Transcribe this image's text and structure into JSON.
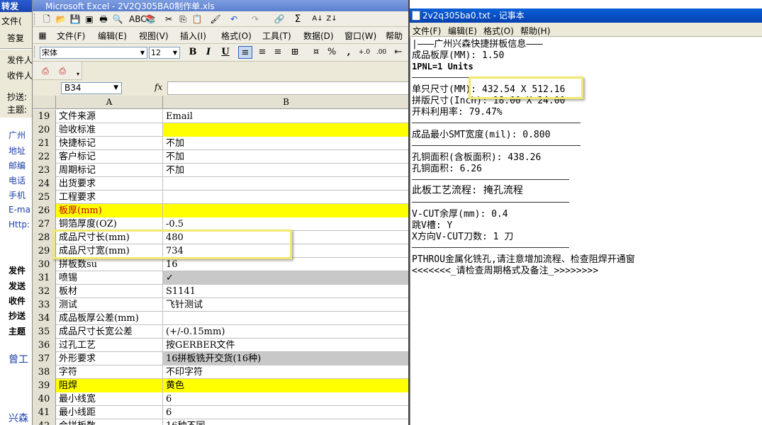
{
  "mail": {
    "title": "转发",
    "toolbar": [
      "文件(",
      "答复"
    ],
    "header_labels": [
      "发件人",
      "收件人",
      "抄送:",
      "主题:"
    ],
    "body_lines": [
      "广州",
      "地址",
      "邮编",
      "电话",
      "手机",
      "E-ma",
      "Http:"
    ],
    "bold_labels": [
      "发件",
      "发送",
      "收件",
      "抄送",
      "主题"
    ],
    "body_text": "曾工",
    "footer": "兴森"
  },
  "excel": {
    "title": "Microsoft Excel - 2V2Q305BA0制作单.xls",
    "menu": [
      "文件(F)",
      "编辑(E)",
      "视图(V)",
      "插入(I)",
      "格式(O)",
      "工具(T)",
      "数据(D)",
      "窗口(W)",
      "帮助"
    ],
    "font_name": "宋体",
    "font_size": "12",
    "fmt_buttons": [
      "B",
      "I",
      "U"
    ],
    "percent": "%",
    "comma": ",",
    "name_box": "B34",
    "fx": "fx",
    "columns": [
      "A",
      "B"
    ],
    "rows": [
      {
        "n": "19",
        "a": "文件来源",
        "b": "Email",
        "style": ""
      },
      {
        "n": "20",
        "a": "验收标准",
        "b": "",
        "style": "yellowB"
      },
      {
        "n": "21",
        "a": "快捷标记",
        "b": "不加",
        "style": ""
      },
      {
        "n": "22",
        "a": "客户标记",
        "b": "不加",
        "style": ""
      },
      {
        "n": "23",
        "a": "周期标记",
        "b": "不加",
        "style": ""
      },
      {
        "n": "24",
        "a": "出货要求",
        "b": "",
        "style": ""
      },
      {
        "n": "25",
        "a": "工程要求",
        "b": "",
        "style": ""
      },
      {
        "n": "26",
        "a": "板厚(mm)",
        "b": "",
        "style": "yellowAll"
      },
      {
        "n": "27",
        "a": "铜箔厚度(OZ)",
        "b": "-0.5",
        "style": ""
      },
      {
        "n": "28",
        "a": "成品尺寸长(mm)",
        "b": "480",
        "style": ""
      },
      {
        "n": "29",
        "a": "成品尺寸宽(mm)",
        "b": "734",
        "style": ""
      },
      {
        "n": "30",
        "a": "拼板数su",
        "b": "16",
        "style": ""
      },
      {
        "n": "31",
        "a": "喷锡",
        "b": "✓",
        "style": "grayB"
      },
      {
        "n": "32",
        "a": "板材",
        "b": "S1141",
        "style": ""
      },
      {
        "n": "33",
        "a": "测试",
        "b": "飞针测试",
        "style": ""
      },
      {
        "n": "34",
        "a": "成品板厚公差(mm)",
        "b": "",
        "style": ""
      },
      {
        "n": "35",
        "a": "成品尺寸长宽公差",
        "b": "(+/-0.15mm)",
        "style": ""
      },
      {
        "n": "36",
        "a": "过孔工艺",
        "b": "按GERBER文件",
        "style": ""
      },
      {
        "n": "37",
        "a": "外形要求",
        "b": "16拼板铣开交货(16种)",
        "style": "grayB"
      },
      {
        "n": "38",
        "a": "字符",
        "b": "不印字符",
        "style": ""
      },
      {
        "n": "39",
        "a": "阻焊",
        "b": "黄色",
        "style": "yellowAll"
      },
      {
        "n": "40",
        "a": "最小线宽",
        "b": "6",
        "style": ""
      },
      {
        "n": "41",
        "a": "最小线距",
        "b": "6",
        "style": ""
      },
      {
        "n": "42",
        "a": "合拼板数",
        "b": "16种不同",
        "style": ""
      }
    ]
  },
  "notepad": {
    "title": "2v2q305ba0.txt - 记事本",
    "menu": [
      "文件(F)",
      "编辑(E)",
      "格式(O)",
      "帮助(H)"
    ],
    "lines": [
      "|———广州兴森快捷拼板信息———",
      "成品板厚(MM): 1.50",
      "1PNL=1 Units",
      "单只尺寸(MM): 432.54 X 512.16",
      "拼版尺寸(Inch): 18.00 X 24.00",
      "开料利用率: 79.47%",
      "成品最小SMT宽度(mil): 0.800",
      "孔铜面积(含板面积): 438.26",
      "孔铜面积: 6.26",
      "此板工艺流程: 掩孔流程",
      "V-CUT余厚(mm): 0.4",
      "跳V槽: Y",
      "X方向V-CUT刀数: 1 刀",
      "PTHROU金属化铣孔,请注意增加流程、检查阻焊开通窗",
      "<<<<<<<_请检查周期格式及备注_>>>>>>>>"
    ]
  },
  "colors": {
    "highlight": "#f0e870",
    "yellow_cell": "#ffff00",
    "gray_cell": "#c8c8c8",
    "title_blue": "#0a5fd8"
  }
}
